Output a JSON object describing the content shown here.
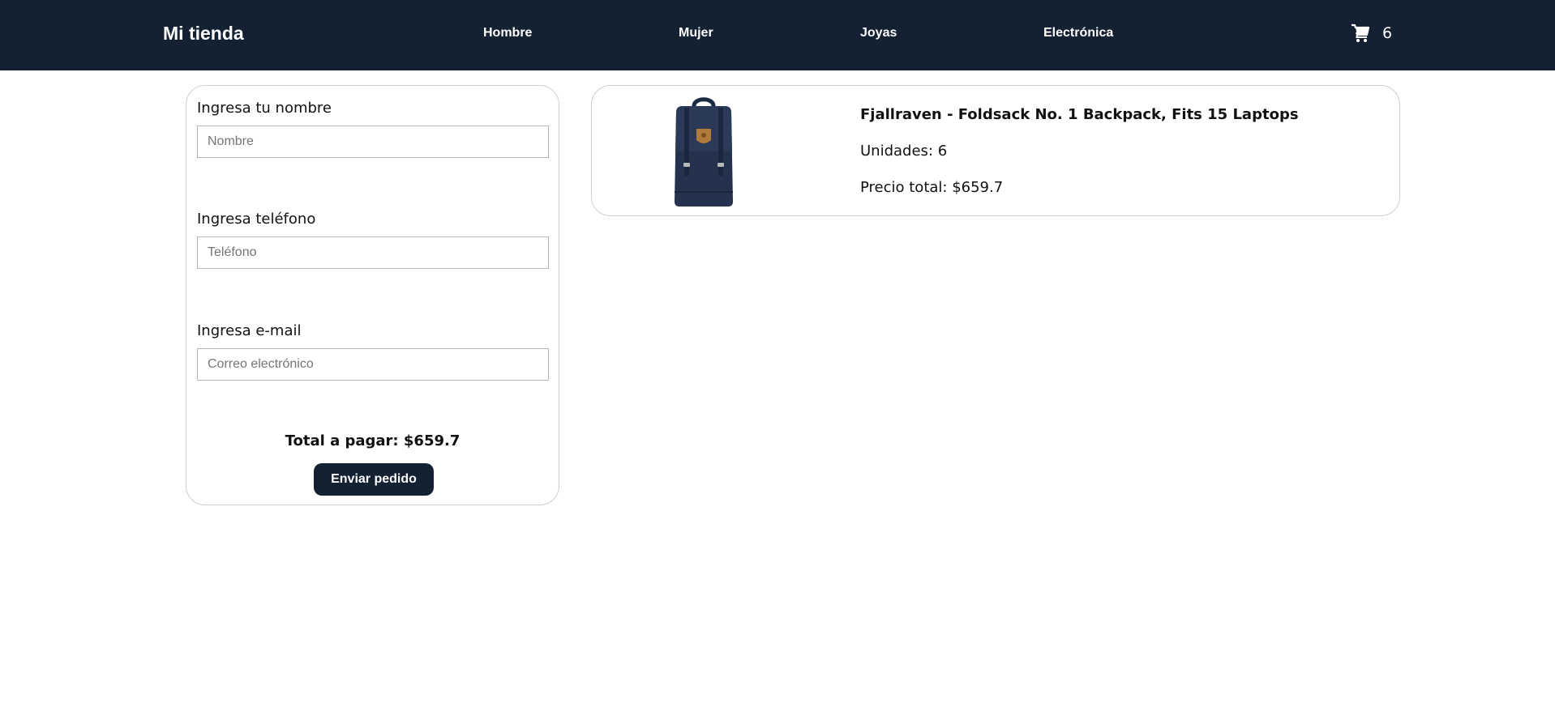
{
  "header": {
    "brand": "Mi tienda",
    "nav": [
      "Hombre",
      "Mujer",
      "Joyas",
      "Electrónica"
    ],
    "cart_count": "6",
    "cart_icon": "shopping-cart-icon"
  },
  "form": {
    "name_label": "Ingresa tu nombre",
    "name_placeholder": "Nombre",
    "name_value": "",
    "phone_label": "Ingresa teléfono",
    "phone_placeholder": "Teléfono",
    "phone_value": "",
    "email_label": "Ingresa e-mail",
    "email_placeholder": "Correo electrónico",
    "email_value": "",
    "total": "Total a pagar: $659.7",
    "submit_label": "Enviar pedido"
  },
  "cart_items": [
    {
      "title": "Fjallraven - Foldsack No. 1 Backpack, Fits 15 Laptops",
      "units": "Unidades: 6",
      "price": "Precio total: $659.7",
      "image_icon": "backpack-image"
    }
  ],
  "colors": {
    "navbar": "#132133",
    "button": "#132133",
    "border": "#cfcfcf",
    "text": "#111111"
  }
}
